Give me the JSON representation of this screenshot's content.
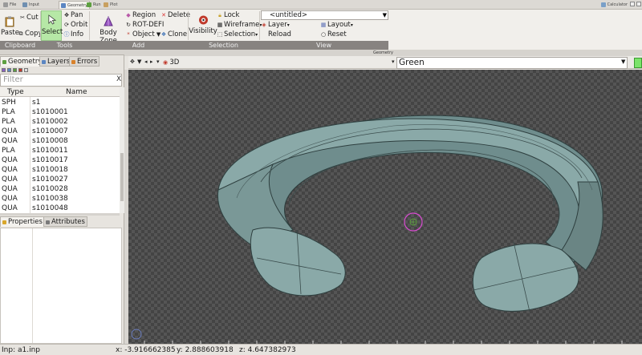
{
  "top_tabs": [
    {
      "label": "File",
      "color": "#9a9a9a"
    },
    {
      "label": "Input",
      "color": "#6f8fb0"
    },
    {
      "label": "Geometry",
      "color": "#5b86c2"
    },
    {
      "label": "Run",
      "color": "#5da040"
    },
    {
      "label": "Plot",
      "color": "#c8a060"
    }
  ],
  "calculator_label": "Calculator",
  "ribbon": {
    "clipboard": {
      "paste": "Paste",
      "cut": "Cut",
      "copy": "Copy"
    },
    "tools": {
      "select": "Select",
      "pan": "Pan",
      "orbit": "Orbit",
      "info": "Info"
    },
    "add": {
      "body_zone": "Body Zone",
      "region": "Region",
      "rot_defi": "ROT-DEFI",
      "object": "Object",
      "delete": "Delete",
      "clone": "Clone"
    },
    "selection": {
      "visibility": "Visibility",
      "lock": "Lock",
      "wireframe": "Wireframe",
      "selection": "Selection"
    },
    "view": {
      "combo_value": "<untitled>",
      "layer": "Layer",
      "layout": "Layout",
      "reload": "Reload",
      "reset": "Reset"
    },
    "group_labels": {
      "clipboard": "Clipboard",
      "tools": "Tools",
      "add": "Add",
      "selection": "Selection",
      "view": "View"
    }
  },
  "viewport_tab_label": "Geometry",
  "left_tabs": {
    "geometry": "Geometry",
    "layers": "Layers",
    "errors": "Errors"
  },
  "filter": {
    "placeholder": "Filter",
    "clear": "X"
  },
  "table": {
    "headers": {
      "type": "Type",
      "name": "Name"
    },
    "rows": [
      {
        "type": "SPH",
        "name": "s1"
      },
      {
        "type": "PLA",
        "name": "s1010001"
      },
      {
        "type": "PLA",
        "name": "s1010002"
      },
      {
        "type": "QUA",
        "name": "s1010007"
      },
      {
        "type": "QUA",
        "name": "s1010008"
      },
      {
        "type": "PLA",
        "name": "s1010011"
      },
      {
        "type": "QUA",
        "name": "s1010017"
      },
      {
        "type": "QUA",
        "name": "s1010018"
      },
      {
        "type": "QUA",
        "name": "s1010027"
      },
      {
        "type": "QUA",
        "name": "s1010028"
      },
      {
        "type": "QUA",
        "name": "s1010038"
      },
      {
        "type": "QUA",
        "name": "s1010048"
      }
    ]
  },
  "prop_tabs": {
    "properties": "Properties",
    "attributes": "Attributes"
  },
  "viewport": {
    "projection": "3D",
    "color_value": "Green",
    "accent": "#7be36a"
  },
  "status": {
    "input": "Inp: a1.inp",
    "x": "x: -3.916662385",
    "y": "y: 2.888603918",
    "z": "z: 4.647382973"
  }
}
